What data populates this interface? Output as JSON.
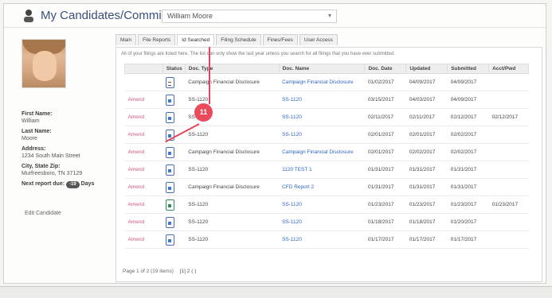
{
  "window": {
    "title": "My Candidates/Committees",
    "user_value": "William Moore"
  },
  "sidebar": {
    "fields": [
      {
        "label": "First Name:",
        "value": "William"
      },
      {
        "label": "Last Name:",
        "value": "Moore"
      },
      {
        "label": "Address:",
        "value": "1234 South Main Street"
      },
      {
        "label": "City, State Zip:",
        "value": "Murfreesboro, TN 37129"
      }
    ],
    "next_report_label": "Next report due:",
    "next_report_days": "-19",
    "next_report_unit": "Days",
    "edit_button": "Edit Candidate"
  },
  "tabs": [
    "Main",
    "File Reports",
    "Id Searched",
    "Filing Schedule",
    "Fines/Fees",
    "User Access"
  ],
  "note": "All of your filings are listed here. The list can only show the last year unless you search for all filings that you have ever submitted.",
  "table": {
    "columns": [
      "",
      "Status",
      "Doc. Type",
      "Doc. Name",
      "Doc. Date",
      "Updated",
      "Submitted",
      "Acct/Pwd"
    ],
    "rows": [
      {
        "action": "",
        "status_icon": "document-outline",
        "type": "Campaign Financial Disclosure",
        "name": "Campaign Financial Disclosure",
        "date": "01/02/2017",
        "updated": "04/09/2017",
        "submitted": "04/09/2017",
        "acct": ""
      },
      {
        "action": "Amend",
        "status_icon": "document-blue",
        "type": "SS-1120",
        "name": "SS-1120",
        "date": "03/15/2017",
        "updated": "04/03/2017",
        "submitted": "04/09/2017",
        "acct": ""
      },
      {
        "action": "Amend",
        "status_icon": "document-blue",
        "type": "SS-1120",
        "name": "SS-1120",
        "date": "02/11/2017",
        "updated": "02/11/2017",
        "submitted": "02/12/2017",
        "acct": "02/12/2017"
      },
      {
        "action": "Amend",
        "status_icon": "document-blue",
        "type": "SS-1120",
        "name": "SS-1120",
        "date": "02/01/2017",
        "updated": "02/01/2017",
        "submitted": "02/02/2017",
        "acct": ""
      },
      {
        "action": "Amend",
        "status_icon": "document-blue",
        "type": "Campaign Financial Disclosure",
        "name": "Campaign Financial Disclosure",
        "date": "02/01/2017",
        "updated": "02/02/2017",
        "submitted": "02/02/2017",
        "acct": ""
      },
      {
        "action": "Amend",
        "status_icon": "document-blue",
        "type": "SS-1120",
        "name": "1120 TEST 1",
        "date": "01/31/2017",
        "updated": "01/31/2017",
        "submitted": "01/31/2017",
        "acct": ""
      },
      {
        "action": "Amend",
        "status_icon": "document-blue",
        "type": "Campaign Financial Disclosure",
        "name": "CFD Report 2",
        "date": "01/31/2017",
        "updated": "01/31/2017",
        "submitted": "01/31/2017",
        "acct": ""
      },
      {
        "action": "Amend",
        "status_icon": "document-green",
        "type": "SS-1120",
        "name": "SS-1120",
        "date": "01/23/2017",
        "updated": "01/23/2017",
        "submitted": "01/23/2017",
        "acct": "01/23/2017"
      },
      {
        "action": "Amend",
        "status_icon": "document-blue",
        "type": "SS-1120",
        "name": "SS-1120",
        "date": "01/18/2017",
        "updated": "01/18/2017",
        "submitted": "01/20/2017",
        "acct": ""
      },
      {
        "action": "Amend",
        "status_icon": "document-blue",
        "type": "SS-1120",
        "name": "SS-1120",
        "date": "01/17/2017",
        "updated": "01/17/2017",
        "submitted": "01/17/2017",
        "acct": ""
      }
    ]
  },
  "footer": {
    "page_info": "Page 1 of 2 (19 items)",
    "pager": "[1] 2 ( )"
  },
  "annotation": {
    "marker_text": "11"
  },
  "colors": {
    "accent": "#2c66c4",
    "amend": "#d9557a",
    "marker": "#ea4b5c"
  }
}
